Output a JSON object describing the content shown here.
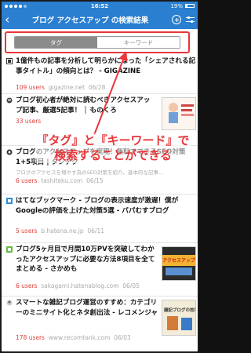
{
  "status": {
    "time": "16:52",
    "battery": "19%"
  },
  "nav": {
    "title": "ブログ アクセスアップ の検索結果"
  },
  "segments": {
    "tag": "タグ",
    "keyword": "キーワード"
  },
  "annotation": {
    "line1": "『タグ』と『キーワード』で",
    "line2": "検索することができる"
  },
  "items": [
    {
      "title": "1億件もの記事を分析して明らかになった「シェアされる記事タイトル」の傾向とは？ - GIGAZINE",
      "users": "109 users",
      "site": "gigazine.net",
      "date": "06/28"
    },
    {
      "title": "ブログ初心者が絶対に読むべきアクセスアップ記事、厳選5記事！ │ ものくろ",
      "users": "33 users",
      "site": "",
      "date": ""
    },
    {
      "title": "ブログのアクセスアップを実現！無料でできるSEO対策1+5項目 | タシテク",
      "users": "6 users",
      "site": "tashiteku.com",
      "date": "06/15",
      "desc": "ブログのアクセスを増やす為のSEO対策を紹介。基本的な記事…"
    },
    {
      "title": "はてなブックマーク - ブログの表示速度が激遅！僕がGoogleの評価を上げた対策5選 - パパむすブログ",
      "users": "5 users",
      "site": "b.hatena.ne.jp",
      "date": "06/11"
    },
    {
      "title": "ブログ5ヶ月目で月間10万PVを突破してわかったアクセスアップに必要な方法8項目を全てまとめる - さかめも",
      "users": "6 users",
      "site": "sakagami.hatenablog.com",
      "date": "06/05",
      "thumb_text": "アクセスアップ"
    },
    {
      "title": "スマートな雑記ブログ運営のすすめ：カテゴリーのミニサイト化とネタ創出法 - レコメンジャ",
      "users": "178 users",
      "site": "www.recomtank.com",
      "date": "06/03",
      "thumb_text": "雑記ブログの効率化"
    }
  ]
}
